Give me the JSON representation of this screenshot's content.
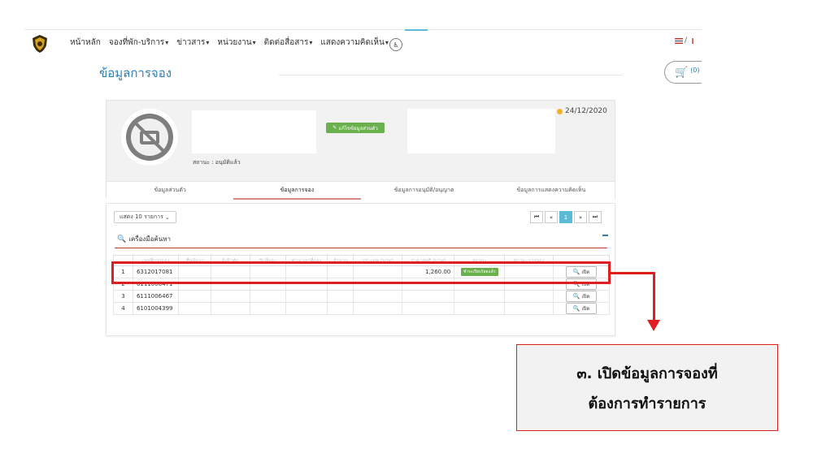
{
  "nav": {
    "items": [
      {
        "label": "หน้าหลัก",
        "dropdown": false
      },
      {
        "label": "จองที่พัก-บริการ",
        "dropdown": true
      },
      {
        "label": "ข่าวสาร",
        "dropdown": true
      },
      {
        "label": "หน่วยงาน",
        "dropdown": true
      },
      {
        "label": "ติดต่อสื่อสาร",
        "dropdown": true
      },
      {
        "label": "แสดงความคิดเห็น",
        "dropdown": true
      }
    ],
    "lang_separator": "/",
    "accent_color": "#5bbbd6"
  },
  "page": {
    "title": "ข้อมูลการจอง",
    "cart_count": "(0)"
  },
  "profile": {
    "status": "สถานะ : อนุมัติแล้ว",
    "edit_label": "แก้ไขข้อมูลส่วนตัว",
    "date": "24/12/2020",
    "tabs": [
      {
        "label": "ข้อมูลส่วนตัว",
        "active": false
      },
      {
        "label": "ข้อมูลการจอง",
        "active": true
      },
      {
        "label": "ข้อมูลการอนุมัติ/อนุญาต",
        "active": false
      },
      {
        "label": "ข้อมูลการแสดงความคิดเห็น",
        "active": false
      }
    ]
  },
  "list": {
    "show_label": "แสดง  10 รายการ",
    "pager": {
      "first": "⏮",
      "prev": "«",
      "page": "1",
      "next": "»",
      "last": "⏭"
    },
    "search_label": "เครื่องมือค้นหา",
    "columns": [
      "",
      "เลขที่การจอง",
      "ชื่อผู้จอง",
      "ผู้เข้าพัก",
      "วันที่จอง",
      "ช่วงเวลาที่จอง",
      "จำนวน",
      "ประเภท (บาท)",
      "ราคาสุทธิ (บาท)",
      "สถานะ",
      "สถานะการจอง",
      ""
    ],
    "rows": [
      {
        "no": "1",
        "booking_no": "6312017081",
        "amount": "1,260.00",
        "status": "ชำระเรียบร้อยแล้ว",
        "action": "เปิด"
      },
      {
        "no": "2",
        "booking_no": "6111006471",
        "amount": "",
        "status": "",
        "action": "เปิด"
      },
      {
        "no": "3",
        "booking_no": "6111006467",
        "amount": "",
        "status": "",
        "action": "เปิด"
      },
      {
        "no": "4",
        "booking_no": "6101004399",
        "amount": "",
        "status": "",
        "action": "เปิด"
      }
    ],
    "paid_color": "#6ab04c"
  },
  "annotation": {
    "line1": "๓. เปิดข้อมูลการจองที่",
    "line2": "ต้องการทำรายการ",
    "color": "#e01e1e"
  }
}
